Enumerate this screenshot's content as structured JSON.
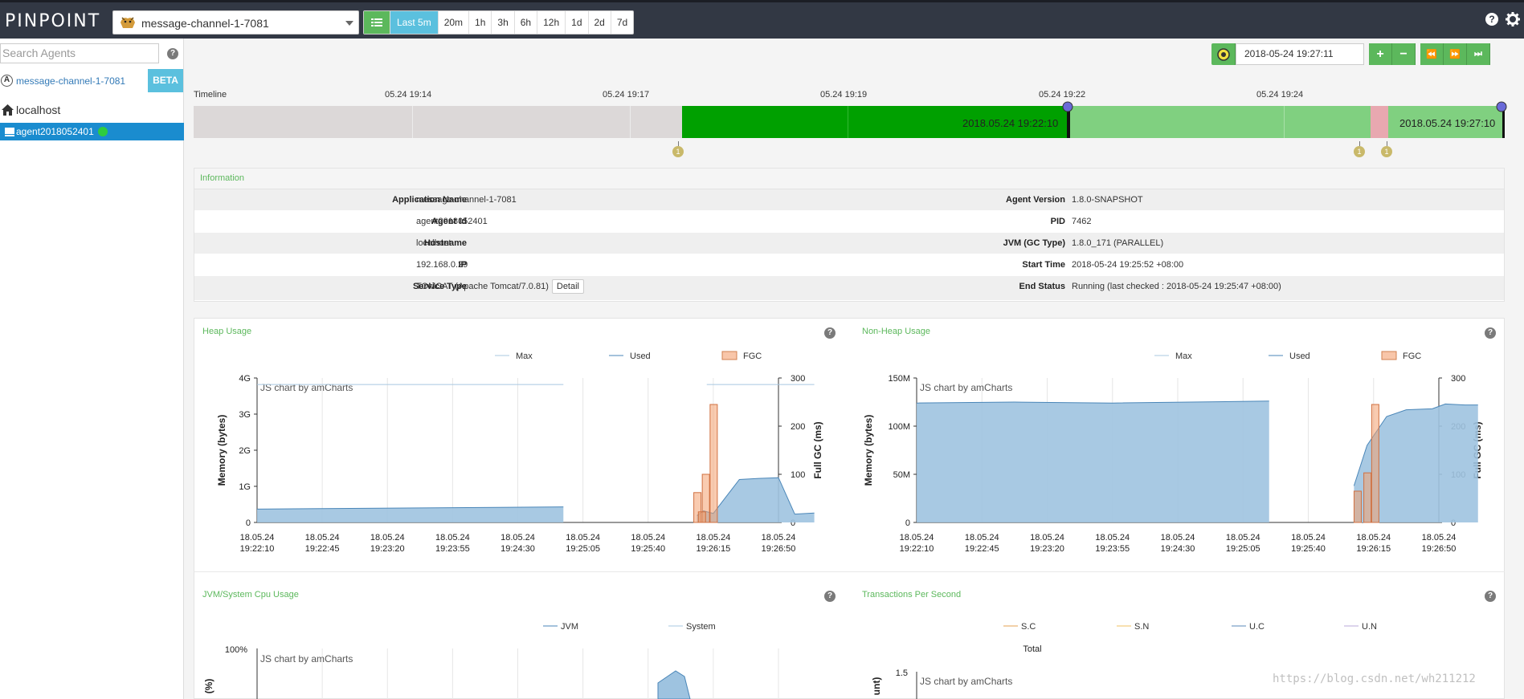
{
  "header": {
    "logo": "PINPOINT",
    "app_selected": "message-channel-1-7081",
    "periods": [
      "Last 5m",
      "20m",
      "1h",
      "3h",
      "6h",
      "12h",
      "1d",
      "2d",
      "7d"
    ],
    "active_period": "Last 5m",
    "icons": [
      "help-icon",
      "settings-icon"
    ]
  },
  "sidebar": {
    "search_placeholder": "Search Agents",
    "app_badge": "A",
    "app_name": "message-channel-1-7081",
    "beta_label": "BETA",
    "host": "localhost",
    "agent": "agent2018052401"
  },
  "datetime": {
    "value": "2018-05-24 19:27:11",
    "buttons": [
      "+",
      "−",
      "⏪",
      "⏩",
      "⏭"
    ]
  },
  "timeline": {
    "label": "Timeline",
    "ticks": [
      "05.24 19:14",
      "05.24 19:17",
      "05.24 19:19",
      "05.24 19:22",
      "05.24 19:24"
    ],
    "from_label": "2018.05.24 19:22:10",
    "to_label": "2018.05.24 19:27:10",
    "event_count": "1",
    "colors": {
      "empty": "#dcdcdc",
      "running": "#00a000",
      "selected": "#80d080",
      "warning": "#e8a8b0"
    }
  },
  "information": {
    "title": "Information",
    "left": [
      {
        "key": "Application Name",
        "value": "message-channel-1-7081"
      },
      {
        "key": "Agent Id",
        "value": "agent2018052401"
      },
      {
        "key": "Hostname",
        "value": "localhost"
      },
      {
        "key": "IP",
        "value": "192.168.0.29"
      },
      {
        "key": "Service Type",
        "value": "TOMCAT (Apache Tomcat/7.0.81)",
        "button": "Detail"
      }
    ],
    "right": [
      {
        "key": "Agent Version",
        "value": "1.8.0-SNAPSHOT"
      },
      {
        "key": "PID",
        "value": "7462"
      },
      {
        "key": "JVM (GC Type)",
        "value": "1.8.0_171 (PARALLEL)"
      },
      {
        "key": "Start Time",
        "value": "2018-05-24 19:25:52 +08:00"
      },
      {
        "key": "End Status",
        "value": "Running (last checked : 2018-05-24 19:25:47 +08:00)"
      }
    ]
  },
  "charts": {
    "credit": "JS chart by amCharts",
    "heap": {
      "title": "Heap Usage",
      "legend": [
        "Max",
        "Used",
        "FGC"
      ],
      "ylabel": "Memory (bytes)",
      "y2label": "Full GC (ms)"
    },
    "nonheap": {
      "title": "Non-Heap Usage",
      "legend": [
        "Max",
        "Used",
        "FGC"
      ],
      "ylabel": "Memory (bytes)",
      "y2label": "Full GC (ms)"
    },
    "cpu": {
      "title": "JVM/System Cpu Usage",
      "legend": [
        "JVM",
        "System"
      ],
      "ylabel": "(%)"
    },
    "tps": {
      "title": "Transactions Per Second",
      "legend": [
        "S.C",
        "S.N",
        "U.C",
        "U.N"
      ],
      "sub": "Total",
      "ylabel": "unt)"
    }
  },
  "chart_data": [
    {
      "type": "area",
      "title": "Heap Usage",
      "ylabel": "Memory (bytes)",
      "y2label": "Full GC (ms)",
      "x_ticks": [
        "18.05.24 19:22:10",
        "18.05.24 19:22:45",
        "18.05.24 19:23:20",
        "18.05.24 19:23:55",
        "18.05.24 19:24:30",
        "18.05.24 19:25:05",
        "18.05.24 19:25:40",
        "18.05.24 19:26:15",
        "18.05.24 19:26:50"
      ],
      "y_ticks": [
        "0",
        "1G",
        "2G",
        "3G",
        "4G"
      ],
      "y2_ticks": [
        "0",
        "100",
        "200",
        "300"
      ],
      "ylim": [
        0,
        4
      ],
      "y2lim": [
        0,
        300
      ],
      "series": [
        {
          "name": "Max",
          "color": "#a8c8e0",
          "segments": [
            [
              [
                0,
                3.82
              ],
              [
                4.7,
                3.82
              ]
            ],
            [
              [
                6.9,
                3.82
              ],
              [
                8.55,
                3.82
              ]
            ]
          ]
        },
        {
          "name": "Used",
          "color": "#4a86b8",
          "segments": [
            [
              [
                0,
                0.37
              ],
              [
                4.7,
                0.43
              ]
            ],
            [
              [
                6.75,
                0.19
              ],
              [
                6.85,
                0.32
              ],
              [
                7.0,
                0.25
              ],
              [
                7.2,
                0.72
              ],
              [
                7.4,
                1.19
              ],
              [
                7.7,
                1.22
              ],
              [
                8.0,
                1.24
              ],
              [
                8.25,
                0.23
              ],
              [
                8.55,
                0.26
              ]
            ]
          ]
        },
        {
          "name": "FGC",
          "color": "#f4a070",
          "bars": [
            [
              6.75,
              62
            ],
            [
              6.88,
              100
            ],
            [
              7.0,
              245
            ],
            [
              6.82,
              22
            ]
          ]
        }
      ]
    },
    {
      "type": "area",
      "title": "Non-Heap Usage",
      "ylabel": "Memory (bytes)",
      "y2label": "Full GC (ms)",
      "x_ticks": [
        "18.05.24 19:22:10",
        "18.05.24 19:22:45",
        "18.05.24 19:23:20",
        "18.05.24 19:23:55",
        "18.05.24 19:24:30",
        "18.05.24 19:25:05",
        "18.05.24 19:25:40",
        "18.05.24 19:26:15",
        "18.05.24 19:26:50"
      ],
      "y_ticks": [
        "0",
        "50M",
        "100M",
        "150M"
      ],
      "y2_ticks": [
        "0",
        "100",
        "200",
        "300"
      ],
      "ylim": [
        0,
        150
      ],
      "y2lim": [
        0,
        300
      ],
      "series": [
        {
          "name": "Max",
          "color": "#a8c8e0",
          "segments": []
        },
        {
          "name": "Used",
          "color": "#4a86b8",
          "segments": [
            [
              [
                0,
                124
              ],
              [
                1.5,
                125
              ],
              [
                3,
                124
              ],
              [
                5.4,
                126
              ]
            ],
            [
              [
                6.7,
                38
              ],
              [
                6.9,
                80
              ],
              [
                7.2,
                110
              ],
              [
                7.5,
                117
              ],
              [
                7.9,
                118
              ],
              [
                8.1,
                123
              ],
              [
                8.4,
                122
              ],
              [
                8.6,
                122
              ]
            ]
          ]
        },
        {
          "name": "FGC",
          "color": "#f4a070",
          "bars": [
            [
              6.75,
              65
            ],
            [
              6.9,
              103
            ],
            [
              7.02,
              245
            ]
          ]
        }
      ]
    },
    {
      "type": "line",
      "title": "JVM/System Cpu Usage",
      "y_ticks": [
        "100%"
      ],
      "series": [
        {
          "name": "JVM",
          "color": "#4a86b8"
        },
        {
          "name": "System",
          "color": "#a8c8e0"
        }
      ]
    },
    {
      "type": "line",
      "title": "Transactions Per Second",
      "y_ticks": [
        "1.5"
      ],
      "series": [
        {
          "name": "S.C",
          "color": "#e6a050"
        },
        {
          "name": "S.N",
          "color": "#f0c060"
        },
        {
          "name": "U.C",
          "color": "#5a8ab8"
        },
        {
          "name": "U.N",
          "color": "#b8a8d8"
        }
      ]
    }
  ],
  "watermark": "https://blog.csdn.net/wh211212"
}
